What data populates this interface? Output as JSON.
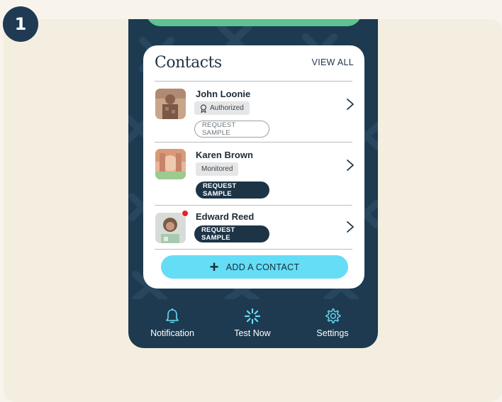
{
  "step": "1",
  "colors": {
    "page_bg": "#f8f4eb",
    "panel_bg": "#f4eee0",
    "phone_bg": "#1d3a50",
    "accent_green": "#5dc391",
    "accent_cyan": "#65ddf6",
    "dark_button": "#1d3447",
    "notification_dot": "#e8202a"
  },
  "contacts": {
    "title": "Contacts",
    "view_all": "VIEW ALL",
    "items": [
      {
        "name": "John Loonie",
        "tag": "Authorized",
        "tag_icon": "award-ribbon-icon",
        "action": "REQUEST SAMPLE",
        "action_style": "outline"
      },
      {
        "name": "Karen Brown",
        "tag": "Monitored",
        "action": "REQUEST SAMPLE",
        "action_style": "filled"
      },
      {
        "name": "Edward Reed",
        "action": "REQUEST SAMPLE",
        "action_style": "filled",
        "notification": true
      }
    ],
    "add_contact": "ADD A CONTACT"
  },
  "nav": {
    "items": [
      {
        "label": "Notification",
        "icon": "bell-icon"
      },
      {
        "label": "Test Now",
        "icon": "spinner-icon"
      },
      {
        "label": "Settings",
        "icon": "gear-icon"
      }
    ]
  }
}
